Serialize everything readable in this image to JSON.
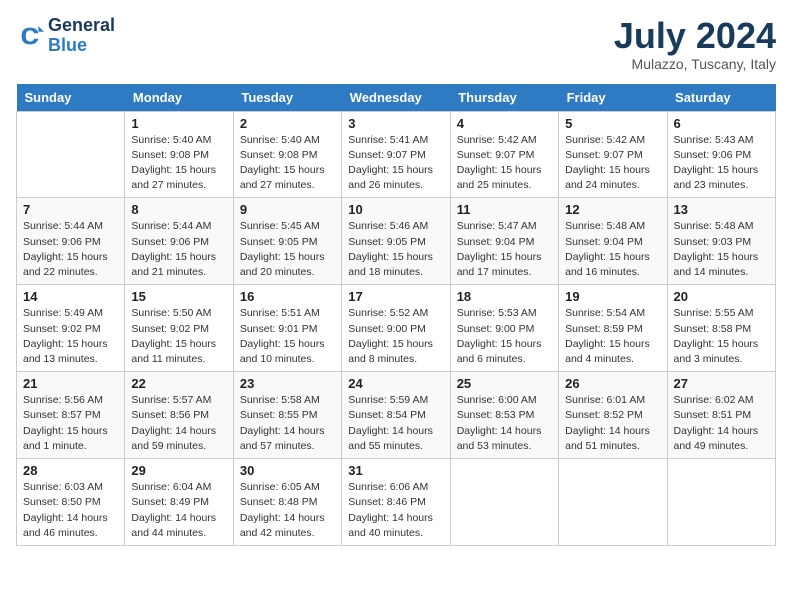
{
  "header": {
    "logo_line1": "General",
    "logo_line2": "Blue",
    "month": "July 2024",
    "location": "Mulazzo, Tuscany, Italy"
  },
  "weekdays": [
    "Sunday",
    "Monday",
    "Tuesday",
    "Wednesday",
    "Thursday",
    "Friday",
    "Saturday"
  ],
  "weeks": [
    [
      {
        "day": "",
        "info": ""
      },
      {
        "day": "1",
        "info": "Sunrise: 5:40 AM\nSunset: 9:08 PM\nDaylight: 15 hours\nand 27 minutes."
      },
      {
        "day": "2",
        "info": "Sunrise: 5:40 AM\nSunset: 9:08 PM\nDaylight: 15 hours\nand 27 minutes."
      },
      {
        "day": "3",
        "info": "Sunrise: 5:41 AM\nSunset: 9:07 PM\nDaylight: 15 hours\nand 26 minutes."
      },
      {
        "day": "4",
        "info": "Sunrise: 5:42 AM\nSunset: 9:07 PM\nDaylight: 15 hours\nand 25 minutes."
      },
      {
        "day": "5",
        "info": "Sunrise: 5:42 AM\nSunset: 9:07 PM\nDaylight: 15 hours\nand 24 minutes."
      },
      {
        "day": "6",
        "info": "Sunrise: 5:43 AM\nSunset: 9:06 PM\nDaylight: 15 hours\nand 23 minutes."
      }
    ],
    [
      {
        "day": "7",
        "info": "Sunrise: 5:44 AM\nSunset: 9:06 PM\nDaylight: 15 hours\nand 22 minutes."
      },
      {
        "day": "8",
        "info": "Sunrise: 5:44 AM\nSunset: 9:06 PM\nDaylight: 15 hours\nand 21 minutes."
      },
      {
        "day": "9",
        "info": "Sunrise: 5:45 AM\nSunset: 9:05 PM\nDaylight: 15 hours\nand 20 minutes."
      },
      {
        "day": "10",
        "info": "Sunrise: 5:46 AM\nSunset: 9:05 PM\nDaylight: 15 hours\nand 18 minutes."
      },
      {
        "day": "11",
        "info": "Sunrise: 5:47 AM\nSunset: 9:04 PM\nDaylight: 15 hours\nand 17 minutes."
      },
      {
        "day": "12",
        "info": "Sunrise: 5:48 AM\nSunset: 9:04 PM\nDaylight: 15 hours\nand 16 minutes."
      },
      {
        "day": "13",
        "info": "Sunrise: 5:48 AM\nSunset: 9:03 PM\nDaylight: 15 hours\nand 14 minutes."
      }
    ],
    [
      {
        "day": "14",
        "info": "Sunrise: 5:49 AM\nSunset: 9:02 PM\nDaylight: 15 hours\nand 13 minutes."
      },
      {
        "day": "15",
        "info": "Sunrise: 5:50 AM\nSunset: 9:02 PM\nDaylight: 15 hours\nand 11 minutes."
      },
      {
        "day": "16",
        "info": "Sunrise: 5:51 AM\nSunset: 9:01 PM\nDaylight: 15 hours\nand 10 minutes."
      },
      {
        "day": "17",
        "info": "Sunrise: 5:52 AM\nSunset: 9:00 PM\nDaylight: 15 hours\nand 8 minutes."
      },
      {
        "day": "18",
        "info": "Sunrise: 5:53 AM\nSunset: 9:00 PM\nDaylight: 15 hours\nand 6 minutes."
      },
      {
        "day": "19",
        "info": "Sunrise: 5:54 AM\nSunset: 8:59 PM\nDaylight: 15 hours\nand 4 minutes."
      },
      {
        "day": "20",
        "info": "Sunrise: 5:55 AM\nSunset: 8:58 PM\nDaylight: 15 hours\nand 3 minutes."
      }
    ],
    [
      {
        "day": "21",
        "info": "Sunrise: 5:56 AM\nSunset: 8:57 PM\nDaylight: 15 hours\nand 1 minute."
      },
      {
        "day": "22",
        "info": "Sunrise: 5:57 AM\nSunset: 8:56 PM\nDaylight: 14 hours\nand 59 minutes."
      },
      {
        "day": "23",
        "info": "Sunrise: 5:58 AM\nSunset: 8:55 PM\nDaylight: 14 hours\nand 57 minutes."
      },
      {
        "day": "24",
        "info": "Sunrise: 5:59 AM\nSunset: 8:54 PM\nDaylight: 14 hours\nand 55 minutes."
      },
      {
        "day": "25",
        "info": "Sunrise: 6:00 AM\nSunset: 8:53 PM\nDaylight: 14 hours\nand 53 minutes."
      },
      {
        "day": "26",
        "info": "Sunrise: 6:01 AM\nSunset: 8:52 PM\nDaylight: 14 hours\nand 51 minutes."
      },
      {
        "day": "27",
        "info": "Sunrise: 6:02 AM\nSunset: 8:51 PM\nDaylight: 14 hours\nand 49 minutes."
      }
    ],
    [
      {
        "day": "28",
        "info": "Sunrise: 6:03 AM\nSunset: 8:50 PM\nDaylight: 14 hours\nand 46 minutes."
      },
      {
        "day": "29",
        "info": "Sunrise: 6:04 AM\nSunset: 8:49 PM\nDaylight: 14 hours\nand 44 minutes."
      },
      {
        "day": "30",
        "info": "Sunrise: 6:05 AM\nSunset: 8:48 PM\nDaylight: 14 hours\nand 42 minutes."
      },
      {
        "day": "31",
        "info": "Sunrise: 6:06 AM\nSunset: 8:46 PM\nDaylight: 14 hours\nand 40 minutes."
      },
      {
        "day": "",
        "info": ""
      },
      {
        "day": "",
        "info": ""
      },
      {
        "day": "",
        "info": ""
      }
    ]
  ]
}
